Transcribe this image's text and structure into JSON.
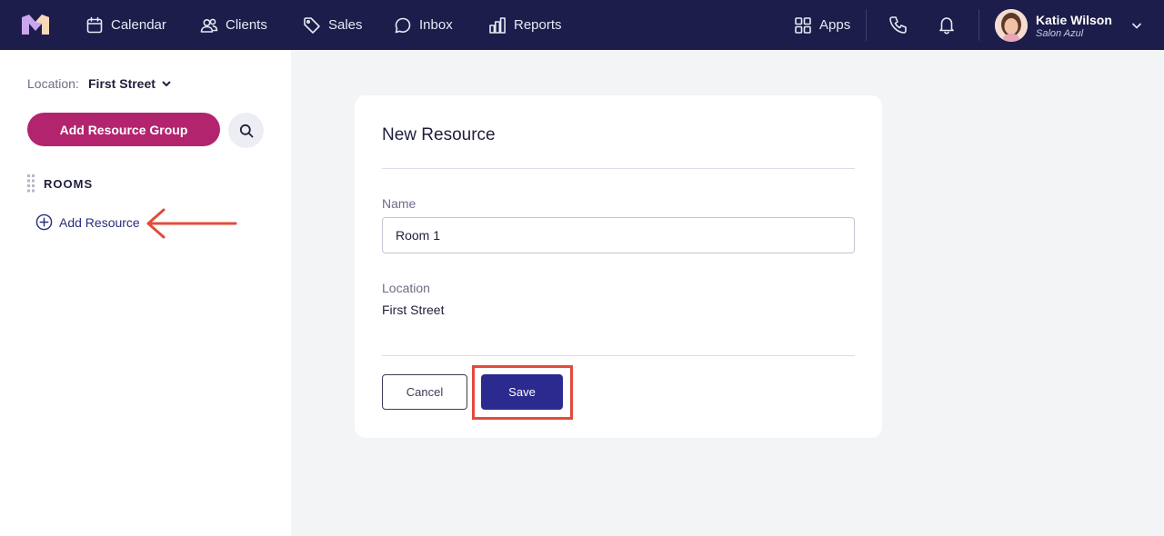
{
  "nav": {
    "items": [
      {
        "label": "Calendar",
        "icon": "calendar-icon"
      },
      {
        "label": "Clients",
        "icon": "users-icon"
      },
      {
        "label": "Sales",
        "icon": "tag-icon"
      },
      {
        "label": "Inbox",
        "icon": "chat-icon"
      },
      {
        "label": "Reports",
        "icon": "bar-chart-icon"
      }
    ],
    "apps_label": "Apps",
    "user": {
      "name": "Katie Wilson",
      "business": "Salon Azul"
    }
  },
  "sidebar": {
    "location_label": "Location:",
    "location_value": "First Street",
    "add_group_label": "Add Resource Group",
    "group_title": "ROOMS",
    "add_resource_label": "Add Resource"
  },
  "card": {
    "title": "New Resource",
    "name_label": "Name",
    "name_value": "Room 1",
    "location_label": "Location",
    "location_value": "First Street",
    "cancel_label": "Cancel",
    "save_label": "Save"
  },
  "colors": {
    "nav_bg": "#1c1d4a",
    "primary_button": "#2b2a8f",
    "add_group_button": "#b3246f",
    "annotation": "#e24b3b"
  }
}
